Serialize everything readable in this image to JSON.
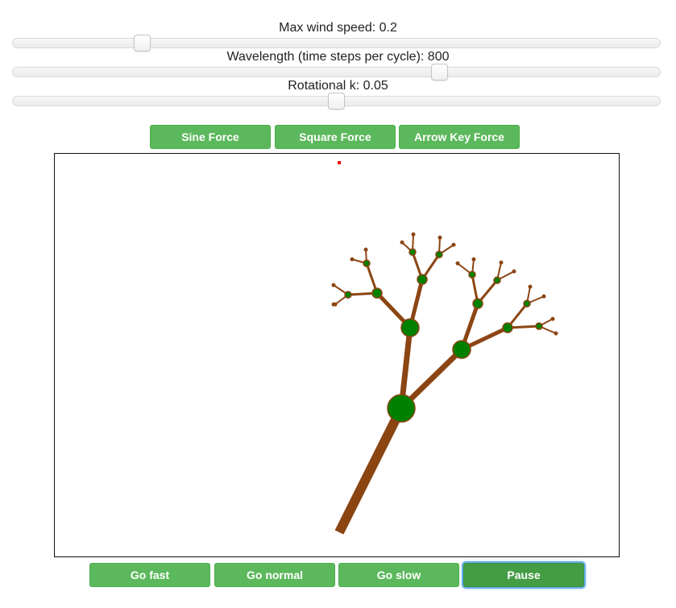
{
  "sliders": [
    {
      "label": "Max wind speed: 0.2",
      "fraction": 0.2
    },
    {
      "label": "Wavelength (time steps per cycle): 800",
      "fraction": 0.66
    },
    {
      "label": "Rotational k: 0.05",
      "fraction": 0.5
    }
  ],
  "force_buttons": [
    "Sine Force",
    "Square Force",
    "Arrow Key Force"
  ],
  "speed_buttons": [
    "Go fast",
    "Go normal",
    "Go slow",
    "Pause"
  ],
  "colors": {
    "branch": "#8b4513",
    "node_fill": "#008000",
    "node_stroke": "#8b4513",
    "wind_marker": "#ff0000",
    "button": "#5cb85c",
    "button_active": "#449d44"
  }
}
